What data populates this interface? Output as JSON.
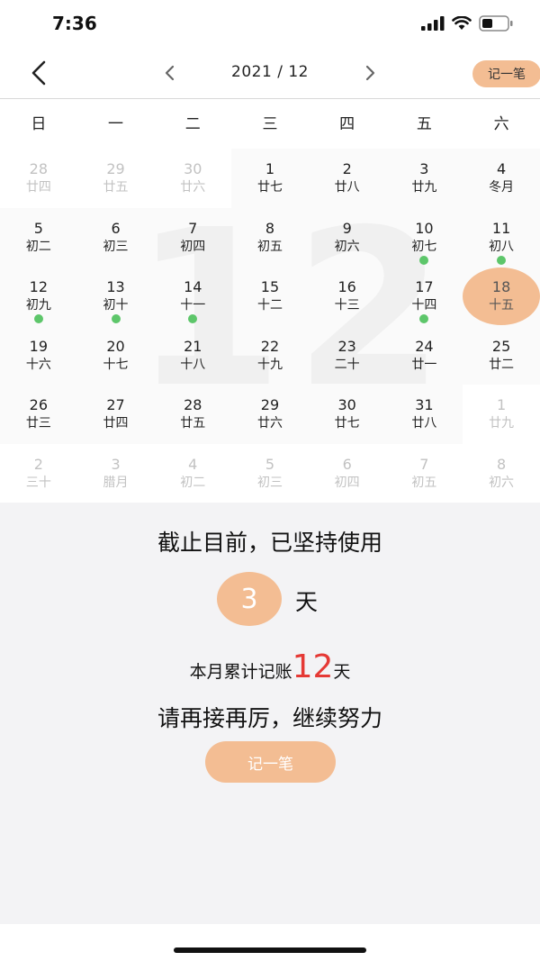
{
  "status_bar": {
    "time": "7:36",
    "icons": [
      "signal-icon",
      "wifi-icon",
      "battery-icon"
    ]
  },
  "nav": {
    "back_icon": "chevron-left-icon",
    "prev_icon": "chevron-left-icon",
    "next_icon": "chevron-right-icon",
    "month_label": "2021 / 12",
    "record_label": "记一笔"
  },
  "weekdays": [
    "日",
    "一",
    "二",
    "三",
    "四",
    "五",
    "六"
  ],
  "calendar": {
    "background_month": "12",
    "cells": [
      {
        "day": "28",
        "lunar": "廿四",
        "faded": true
      },
      {
        "day": "29",
        "lunar": "廿五",
        "faded": true
      },
      {
        "day": "30",
        "lunar": "廿六",
        "faded": true
      },
      {
        "day": "1",
        "lunar": "廿七"
      },
      {
        "day": "2",
        "lunar": "廿八"
      },
      {
        "day": "3",
        "lunar": "廿九"
      },
      {
        "day": "4",
        "lunar": "冬月"
      },
      {
        "day": "5",
        "lunar": "初二"
      },
      {
        "day": "6",
        "lunar": "初三"
      },
      {
        "day": "7",
        "lunar": "初四"
      },
      {
        "day": "8",
        "lunar": "初五"
      },
      {
        "day": "9",
        "lunar": "初六"
      },
      {
        "day": "10",
        "lunar": "初七",
        "dot": true
      },
      {
        "day": "11",
        "lunar": "初八",
        "dot": true
      },
      {
        "day": "12",
        "lunar": "初九",
        "dot": true
      },
      {
        "day": "13",
        "lunar": "初十",
        "dot": true
      },
      {
        "day": "14",
        "lunar": "十一",
        "dot": true
      },
      {
        "day": "15",
        "lunar": "十二"
      },
      {
        "day": "16",
        "lunar": "十三"
      },
      {
        "day": "17",
        "lunar": "十四",
        "dot": true
      },
      {
        "day": "18",
        "lunar": "十五",
        "selected": true
      },
      {
        "day": "19",
        "lunar": "十六"
      },
      {
        "day": "20",
        "lunar": "十七"
      },
      {
        "day": "21",
        "lunar": "十八"
      },
      {
        "day": "22",
        "lunar": "十九"
      },
      {
        "day": "23",
        "lunar": "二十"
      },
      {
        "day": "24",
        "lunar": "廿一"
      },
      {
        "day": "25",
        "lunar": "廿二"
      },
      {
        "day": "26",
        "lunar": "廿三"
      },
      {
        "day": "27",
        "lunar": "廿四"
      },
      {
        "day": "28",
        "lunar": "廿五"
      },
      {
        "day": "29",
        "lunar": "廿六"
      },
      {
        "day": "30",
        "lunar": "廿七"
      },
      {
        "day": "31",
        "lunar": "廿八"
      },
      {
        "day": "1",
        "lunar": "廿九",
        "faded": true
      },
      {
        "day": "2",
        "lunar": "三十",
        "faded": true
      },
      {
        "day": "3",
        "lunar": "腊月",
        "faded": true
      },
      {
        "day": "4",
        "lunar": "初二",
        "faded": true
      },
      {
        "day": "5",
        "lunar": "初三",
        "faded": true
      },
      {
        "day": "6",
        "lunar": "初四",
        "faded": true
      },
      {
        "day": "7",
        "lunar": "初五",
        "faded": true
      },
      {
        "day": "8",
        "lunar": "初六",
        "faded": true
      }
    ]
  },
  "summary": {
    "title": "截止目前，已坚持使用",
    "days": "3",
    "days_unit": "天",
    "month_pre": "本月累计记账",
    "month_count": "12",
    "month_post": "天",
    "encourage": "请再接再厉，继续努力",
    "record_button": "记一笔"
  },
  "colors": {
    "accent": "#f3bd93",
    "dot": "#5dc66a",
    "highlight_number": "#e53935"
  }
}
